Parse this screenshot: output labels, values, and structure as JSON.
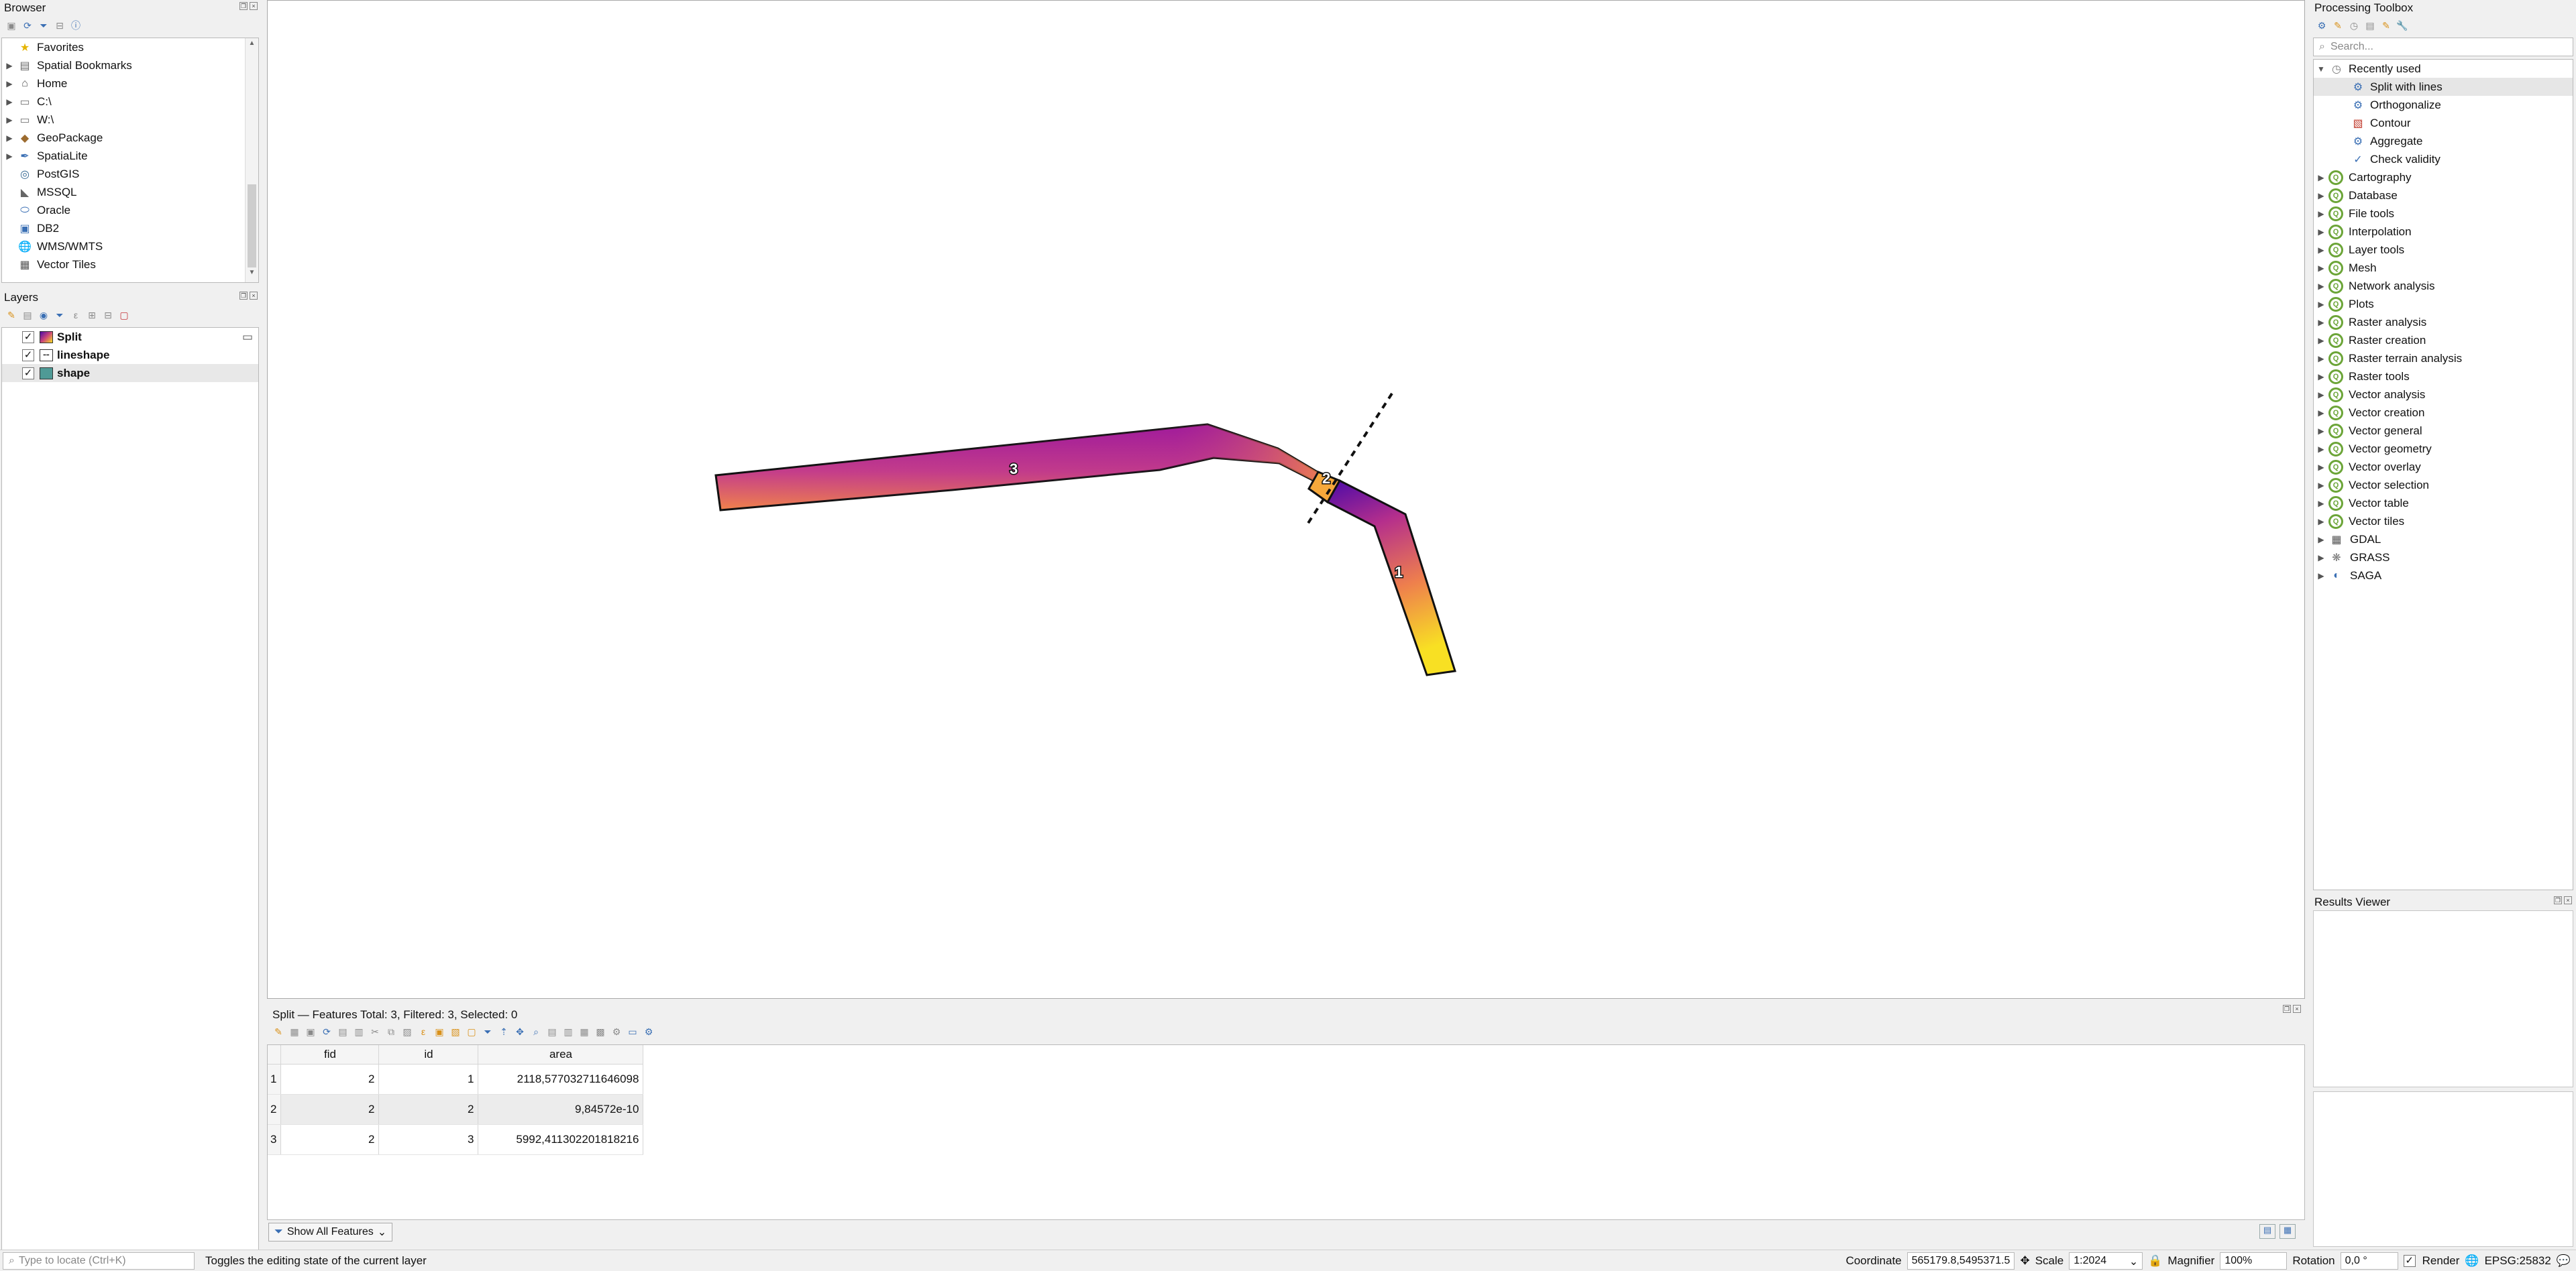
{
  "browser": {
    "title": "Browser",
    "items": [
      {
        "label": "Favorites",
        "icon": "star-icon",
        "expandable": false
      },
      {
        "label": "Spatial Bookmarks",
        "icon": "bookmark-icon",
        "expandable": true
      },
      {
        "label": "Home",
        "icon": "home-icon",
        "expandable": true
      },
      {
        "label": "C:\\",
        "icon": "folder-icon",
        "expandable": true
      },
      {
        "label": "W:\\",
        "icon": "folder-icon",
        "expandable": true
      },
      {
        "label": "GeoPackage",
        "icon": "geopackage-icon",
        "expandable": true
      },
      {
        "label": "SpatiaLite",
        "icon": "spatialite-icon",
        "expandable": true
      },
      {
        "label": "PostGIS",
        "icon": "postgis-icon",
        "expandable": false
      },
      {
        "label": "MSSQL",
        "icon": "mssql-icon",
        "expandable": false
      },
      {
        "label": "Oracle",
        "icon": "oracle-icon",
        "expandable": false
      },
      {
        "label": "DB2",
        "icon": "db2-icon",
        "expandable": false
      },
      {
        "label": "WMS/WMTS",
        "icon": "wms-icon",
        "expandable": false
      },
      {
        "label": "Vector Tiles",
        "icon": "vector-tiles-icon",
        "expandable": false
      }
    ]
  },
  "layers": {
    "title": "Layers",
    "items": [
      {
        "label": "Split",
        "icon": "gradient-fill-icon",
        "checked": "✓"
      },
      {
        "label": "lineshape",
        "icon": "dashed-line-icon",
        "checked": "✓"
      },
      {
        "label": "shape",
        "icon": "teal-fill-icon",
        "checked": "✓"
      }
    ]
  },
  "map": {
    "labels": [
      "3",
      "2",
      "1"
    ]
  },
  "attribute_table": {
    "title": "Split — Features Total: 3, Filtered: 3, Selected: 0",
    "columns": [
      "fid",
      "id",
      "area"
    ],
    "rows": [
      {
        "n": "1",
        "fid": "2",
        "id": "1",
        "area": "2118,577032711646098"
      },
      {
        "n": "2",
        "fid": "2",
        "id": "2",
        "area": "9,84572e-10"
      },
      {
        "n": "3",
        "fid": "2",
        "id": "3",
        "area": "5992,411302201818216"
      }
    ],
    "show_all_label": "Show All Features"
  },
  "toolbox": {
    "title": "Processing Toolbox",
    "search_placeholder": "Search...",
    "recent_label": "Recently used",
    "recent": [
      {
        "label": "Split with lines",
        "icon": "gear-icon",
        "selected": true
      },
      {
        "label": "Orthogonalize",
        "icon": "gear-icon",
        "selected": false
      },
      {
        "label": "Contour",
        "icon": "contour-icon",
        "selected": false
      },
      {
        "label": "Aggregate",
        "icon": "gear-icon",
        "selected": false
      },
      {
        "label": "Check validity",
        "icon": "checkmark-icon",
        "selected": false
      }
    ],
    "groups": [
      {
        "label": "Cartography",
        "icon": "qgis-icon"
      },
      {
        "label": "Database",
        "icon": "qgis-icon"
      },
      {
        "label": "File tools",
        "icon": "qgis-icon"
      },
      {
        "label": "Interpolation",
        "icon": "qgis-icon"
      },
      {
        "label": "Layer tools",
        "icon": "qgis-icon"
      },
      {
        "label": "Mesh",
        "icon": "qgis-icon"
      },
      {
        "label": "Network analysis",
        "icon": "qgis-icon"
      },
      {
        "label": "Plots",
        "icon": "qgis-icon"
      },
      {
        "label": "Raster analysis",
        "icon": "qgis-icon"
      },
      {
        "label": "Raster creation",
        "icon": "qgis-icon"
      },
      {
        "label": "Raster terrain analysis",
        "icon": "qgis-icon"
      },
      {
        "label": "Raster tools",
        "icon": "qgis-icon"
      },
      {
        "label": "Vector analysis",
        "icon": "qgis-icon"
      },
      {
        "label": "Vector creation",
        "icon": "qgis-icon"
      },
      {
        "label": "Vector general",
        "icon": "qgis-icon"
      },
      {
        "label": "Vector geometry",
        "icon": "qgis-icon"
      },
      {
        "label": "Vector overlay",
        "icon": "qgis-icon"
      },
      {
        "label": "Vector selection",
        "icon": "qgis-icon"
      },
      {
        "label": "Vector table",
        "icon": "qgis-icon"
      },
      {
        "label": "Vector tiles",
        "icon": "qgis-icon"
      },
      {
        "label": "GDAL",
        "icon": "gdal-icon"
      },
      {
        "label": "GRASS",
        "icon": "grass-icon"
      },
      {
        "label": "SAGA",
        "icon": "saga-icon"
      }
    ]
  },
  "results": {
    "title": "Results Viewer"
  },
  "status": {
    "locate_placeholder": "Type to locate (Ctrl+K)",
    "message": "Toggles the editing state of the current layer",
    "coordinate_label": "Coordinate",
    "coordinate_value": "565179.8,5495371.5",
    "scale_label": "Scale",
    "scale_value": "1:2024",
    "magnifier_label": "Magnifier",
    "magnifier_value": "100%",
    "rotation_label": "Rotation",
    "rotation_value": "0,0 °",
    "render_label": "Render",
    "crs": "EPSG:25832"
  },
  "colors": {
    "accent": "#3a6fb4",
    "qgis_green": "#6ca538",
    "plasma_dark": "#4b0aa8",
    "plasma_yellow": "#f6e023"
  }
}
